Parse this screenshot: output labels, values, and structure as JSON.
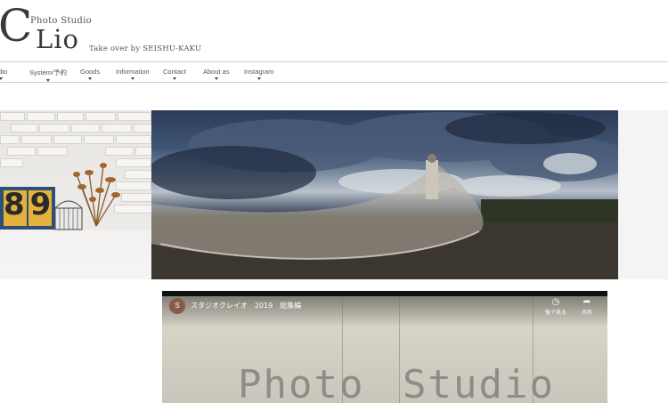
{
  "brand": {
    "c": "C",
    "photo_studio": "Photo  Studio",
    "lio": "Lio",
    "tagline": "Take over by  SEISHU-KAKU"
  },
  "nav": {
    "items": [
      {
        "label": "udio"
      },
      {
        "label": "System/予約"
      },
      {
        "label": "Goods"
      },
      {
        "label": "Information"
      },
      {
        "label": "Contact"
      },
      {
        "label": "About as"
      },
      {
        "label": "Instagram"
      }
    ]
  },
  "hero": {
    "sign_number": "89"
  },
  "video": {
    "channel_initial": "S",
    "title": "スタジオクレイオ　2019　総集編",
    "watch_later_icon": "clock-icon",
    "watch_later_label": "後で見る",
    "share_icon": "share-icon",
    "share_label": "共有",
    "overlay_word1": "Photo",
    "overlay_word2": "Studio"
  },
  "colors": {
    "nav_border": "#cfcfcf",
    "sky_dark": "#2b3b58",
    "video_bg": "#d7d3c6"
  }
}
